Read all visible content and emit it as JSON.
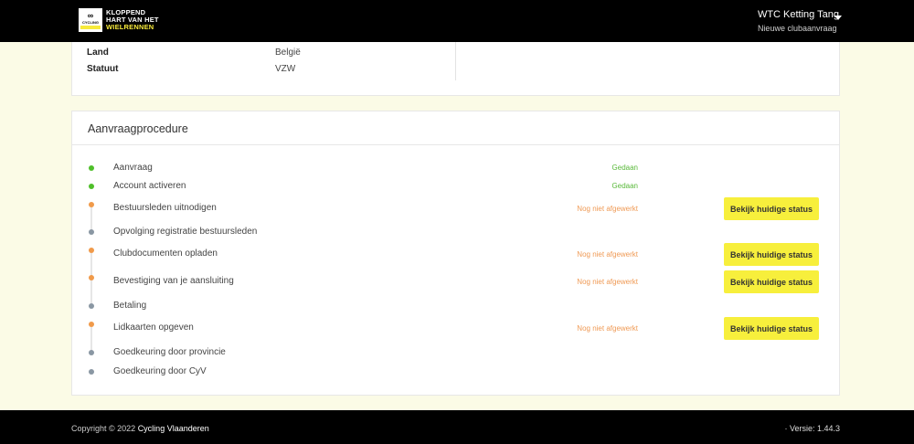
{
  "header": {
    "logo_line1": "KLOPPEND",
    "logo_line2": "HART VAN HET",
    "logo_line3": "WIELRENNEN",
    "badge_top": "CYCLING",
    "badge_bottom": "VLAANDEREN",
    "user_name": "WTC Ketting Tang",
    "user_subtitle": "Nieuwe clubaanvraag"
  },
  "club_info": {
    "rows": [
      {
        "label": "Land",
        "value": "België"
      },
      {
        "label": "Statuut",
        "value": "VZW"
      }
    ]
  },
  "procedure": {
    "title": "Aanvraagprocedure",
    "button_label": "Bekijk huidige status",
    "steps": [
      {
        "label": "Aanvraag",
        "status": "Gedaan",
        "state": "done"
      },
      {
        "label": "Account activeren",
        "status": "Gedaan",
        "state": "done"
      },
      {
        "label": "Bestuursleden uitnodigen",
        "status": "Nog niet afgewerkt",
        "state": "todo"
      },
      {
        "label": "Opvolging registratie bestuursleden",
        "status": "",
        "state": "pending"
      },
      {
        "label": "Clubdocumenten opladen",
        "status": "Nog niet afgewerkt",
        "state": "todo"
      },
      {
        "label": "Bevestiging van je aansluiting",
        "status": "Nog niet afgewerkt",
        "state": "todo"
      },
      {
        "label": "Betaling",
        "status": "",
        "state": "pending"
      },
      {
        "label": "Lidkaarten opgeven",
        "status": "Nog niet afgewerkt",
        "state": "todo"
      },
      {
        "label": "Goedkeuring door provincie",
        "status": "",
        "state": "pending"
      },
      {
        "label": "Goedkeuring door CyV",
        "status": "",
        "state": "pending"
      }
    ]
  },
  "footer": {
    "copyright_prefix": "Copyright © 2022",
    "copyright_link": "Cycling Vlaanderen",
    "version": "· Versie: 1.44.3"
  },
  "colors": {
    "accent_yellow": "#f7ef3c",
    "done_green": "#4fbf2a",
    "todo_orange": "#f09a4a",
    "pending_grey": "#8a97a3"
  }
}
